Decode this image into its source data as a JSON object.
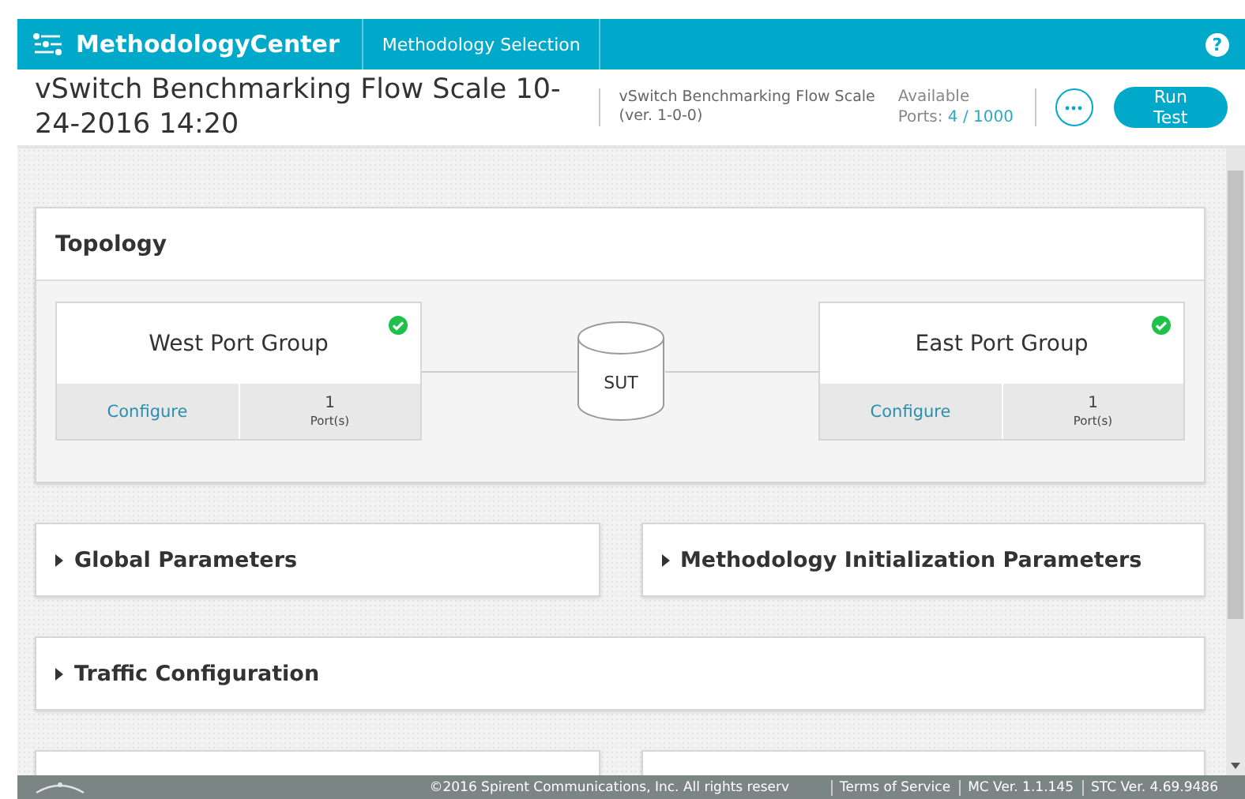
{
  "header": {
    "app_name": "MethodologyCenter",
    "nav_tab": {
      "label": "Methodology Selection",
      "selected": false
    },
    "help": "?"
  },
  "test": {
    "title": "vSwitch Benchmarking Flow Scale 10-24-2016 14:20",
    "methodology": "vSwitch Benchmarking Flow Scale",
    "version": "(ver. 1-0-0)",
    "ports_label": "Available",
    "ports_prefix": "Ports:",
    "ports_value": "4 / 1000",
    "run_button": "Run Test"
  },
  "topology": {
    "title": "Topology",
    "sut": "SUT",
    "groups": [
      {
        "name": "West Port Group",
        "configured": true,
        "configure_link": "Configure",
        "port_count": "1",
        "port_unit": "Port(s)"
      },
      {
        "name": "East Port Group",
        "configured": true,
        "configure_link": "Configure",
        "port_count": "1",
        "port_unit": "Port(s)"
      }
    ]
  },
  "sections": [
    {
      "kind": "half",
      "title": "Global Parameters",
      "expanded": false
    },
    {
      "kind": "half",
      "title": "Methodology Initialization Parameters",
      "expanded": false
    },
    {
      "kind": "full",
      "title": "Traffic Configuration",
      "expanded": false
    },
    {
      "kind": "half"
    },
    {
      "kind": "half"
    }
  ],
  "footer": {
    "copyright": "©2016 Spirent Communications, Inc. All rights reserv",
    "links": [
      "Terms of Service",
      "MC Ver. 1.1.145",
      "STC Ver. 4.69.9486"
    ]
  }
}
